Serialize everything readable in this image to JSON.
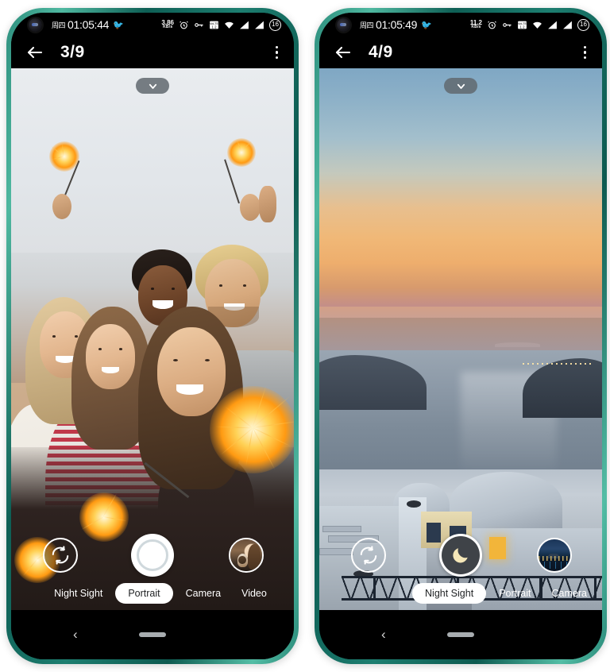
{
  "page": {
    "background": "#ffffff",
    "frame_color": "#1d7e70"
  },
  "phones": [
    {
      "id": "left-phone",
      "status_bar": {
        "day": "周四",
        "time": "01:05:44",
        "emoji": "🐦",
        "network_rate": "3.86",
        "network_unit": "KB/s",
        "icons": [
          "alarm-icon",
          "vpn-key-icon",
          "sim-card-icon",
          "wifi-icon",
          "signal-icon",
          "signal-icon"
        ],
        "battery": "16"
      },
      "app_bar": {
        "back_label": "←",
        "title": "3/9",
        "menu_label": "⋮"
      },
      "viewport": {
        "collapse_label": "⌄",
        "photo_name": "friends-with-sparklers-beach"
      },
      "controls": {
        "flip_camera_label": "flip-camera",
        "shutter_label": "shutter",
        "shutter_style": "photo",
        "thumbnail_label": "last-photo-thumbnail",
        "thumbnail_name": "woman-with-dog-thumbnail"
      },
      "modes": [
        {
          "label": "Night Sight",
          "active": false
        },
        {
          "label": "Portrait",
          "active": true
        },
        {
          "label": "Camera",
          "active": false
        },
        {
          "label": "Video",
          "active": false
        }
      ],
      "nav_bar": {
        "back": "‹",
        "home": "home-pill"
      }
    },
    {
      "id": "right-phone",
      "status_bar": {
        "day": "周四",
        "time": "01:05:49",
        "emoji": "🐦",
        "network_rate": "11.2",
        "network_unit": "KB/s",
        "icons": [
          "alarm-icon",
          "vpn-key-icon",
          "sim-card-icon",
          "wifi-icon",
          "signal-icon",
          "signal-icon"
        ],
        "battery": "16"
      },
      "app_bar": {
        "back_label": "←",
        "title": "4/9",
        "menu_label": "⋮"
      },
      "viewport": {
        "collapse_label": "⌄",
        "photo_name": "santorini-sunset-seaview"
      },
      "controls": {
        "flip_camera_label": "flip-camera",
        "shutter_label": "shutter",
        "shutter_style": "night",
        "thumbnail_label": "last-photo-thumbnail",
        "thumbnail_name": "night-cityscape-thumbnail"
      },
      "modes": [
        {
          "label": "Night Sight",
          "active": true
        },
        {
          "label": "Portrait",
          "active": false
        },
        {
          "label": "Camera",
          "active": false
        }
      ],
      "nav_bar": {
        "back": "‹",
        "home": "home-pill"
      }
    }
  ]
}
